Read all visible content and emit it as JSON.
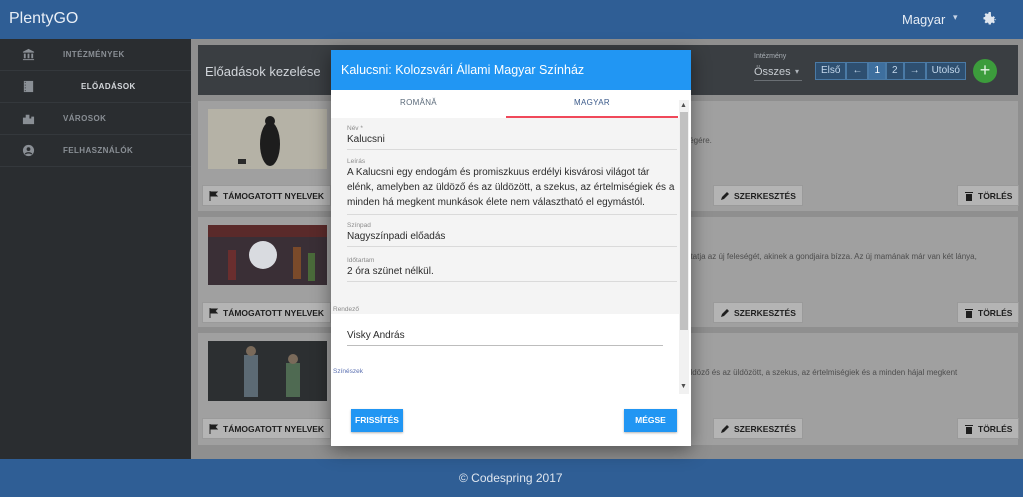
{
  "app": {
    "brand": "PlentyGO",
    "language": "Magyar"
  },
  "sidebar": {
    "items": [
      {
        "label": "INTÉZMÉNYEK",
        "icon": "bank-icon"
      },
      {
        "label": "ELŐADÁSOK",
        "icon": "film-icon"
      },
      {
        "label": "VÁROSOK",
        "icon": "city-icon"
      },
      {
        "label": "FELHASZNÁLÓK",
        "icon": "user-icon"
      }
    ]
  },
  "page": {
    "title": "Előadások kezelése",
    "institution_label": "Intézmény",
    "institution_value": "Összes",
    "pager": {
      "first": "Első",
      "prev": "←",
      "pages": [
        "1",
        "2"
      ],
      "next": "→",
      "last": "Utolsó"
    },
    "add_label": "+"
  },
  "cards": [
    {
      "desc": "y végére.",
      "lang_btn": "TÁMOGATOTT NYELVEK",
      "edit_btn": "SZERKESZTÉS",
      "delete_btn": "TÖRLÉS"
    },
    {
      "desc": "utatja az új feleségét, akinek a gondjaira bízza. Az új mamának már van két lánya,",
      "lang_btn": "TÁMOGATOTT NYELVEK",
      "edit_btn": "SZERKESZTÉS",
      "delete_btn": "TÖRLÉS"
    },
    {
      "desc": "üldöző és az üldözött, a szekus, az értelmiségiek és a minden hájal megkent",
      "lang_btn": "TÁMOGATOTT NYELVEK",
      "edit_btn": "SZERKESZTÉS",
      "delete_btn": "TÖRLÉS"
    }
  ],
  "modal": {
    "title": "Kalucsni: Kolozsvári Állami Magyar Színház",
    "tabs": [
      "ROMÂNĂ",
      "MAGYAR"
    ],
    "fields": {
      "name_label": "Név *",
      "name_value": "Kalucsni",
      "desc_label": "Leírás",
      "desc_value": "A Kalucsni egy endogám és promiszkuus erdélyi kisvárosi világot tár elénk, amelyben az üldöző és az üldözött, a szekus, az értelmiségiek és a minden há megkent munkások élete nem választható el egymástól.",
      "stage_label": "Színpad",
      "stage_value": "Nagyszínpadi előadás",
      "duration_label": "Időtartam",
      "duration_value": "2 óra szünet nélkül.",
      "director_label": "Rendező",
      "director_value": "Visky András",
      "actors_label": "Színészek"
    },
    "update_btn": "FRISSÍTÉS",
    "cancel_btn": "MÉGSE"
  },
  "footer": {
    "text": "© Codespring 2017"
  }
}
